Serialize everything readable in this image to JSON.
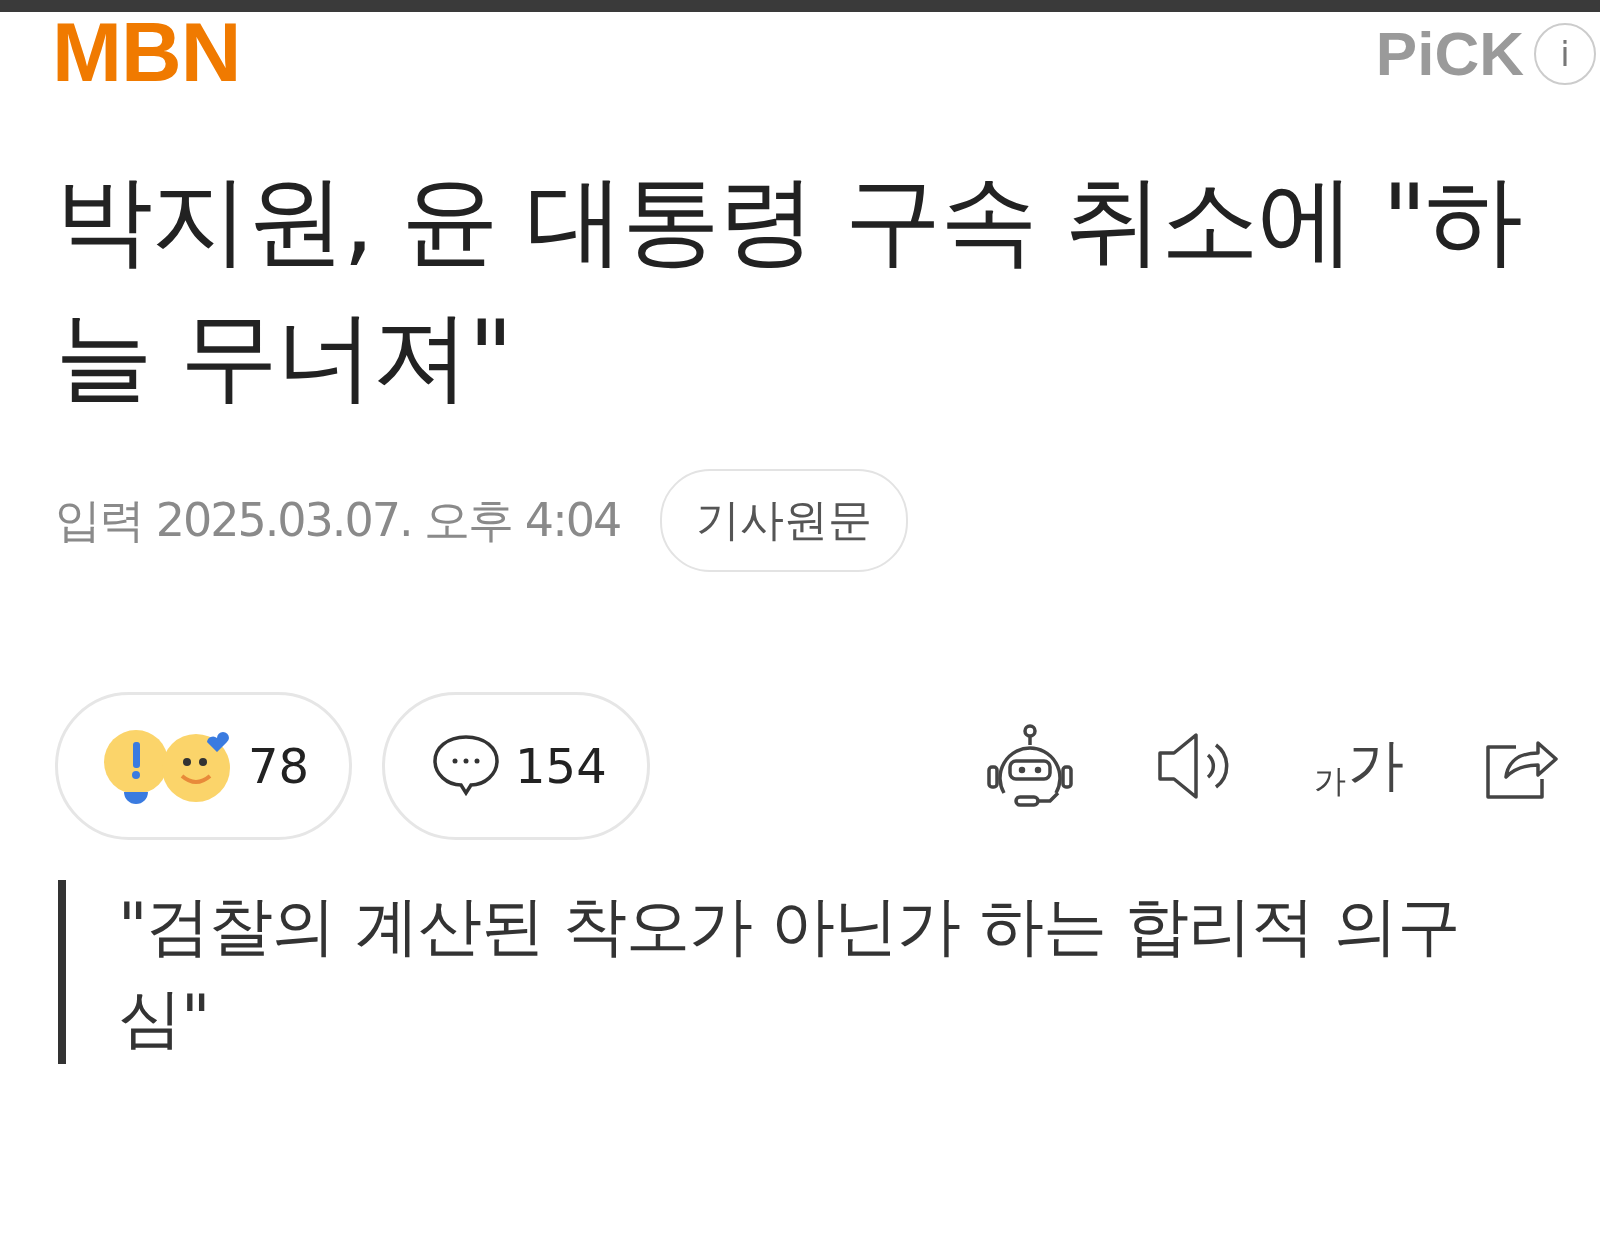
{
  "header": {
    "logo": "MBN",
    "pick_label": "PiCK",
    "info_label": "i"
  },
  "headline": "박지원, 윤 대통령 구속 취소에 \"하늘 무너져\"",
  "meta": {
    "input_label": "입력",
    "timestamp": "2025.03.07. 오후 4:04",
    "original_link": "기사원문"
  },
  "reactions": {
    "count": "78"
  },
  "comments": {
    "count": "154"
  },
  "tools": {
    "font_size_small": "가",
    "font_size_large": "가"
  },
  "quote": "\"검찰의 계산된 착오가 아닌가 하는 합리적 의구심\""
}
